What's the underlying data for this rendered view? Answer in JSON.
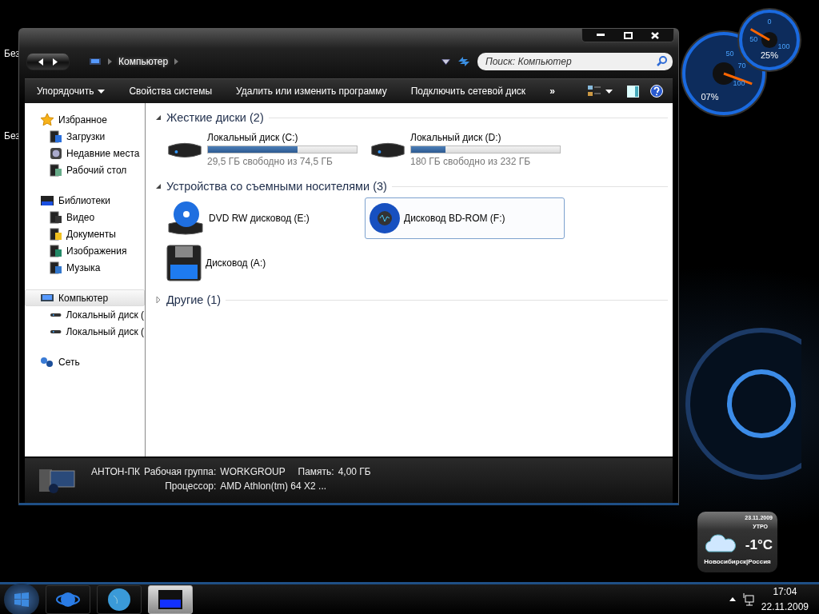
{
  "desktop": {
    "icon_labels": [
      "Без",
      "Без"
    ]
  },
  "gauges": [
    {
      "ticks": [
        "50",
        "70",
        "100"
      ],
      "reading": "07%"
    },
    {
      "ticks": [
        "0",
        "50",
        "100"
      ],
      "reading": "25%"
    }
  ],
  "window": {
    "breadcrumb": [
      "Компьютер"
    ],
    "search": {
      "placeholder": "Поиск: Компьютер"
    },
    "toolbar": {
      "items": [
        {
          "label": "Упорядочить",
          "kind": "menu"
        },
        {
          "label": "Свойства системы",
          "kind": "button"
        },
        {
          "label": "Удалить или изменить программу",
          "kind": "button"
        },
        {
          "label": "Подключить сетевой диск",
          "kind": "button"
        }
      ],
      "overflow": "»"
    },
    "sidebar": [
      {
        "label": "Избранное",
        "selected": false,
        "children": [
          {
            "label": "Загрузки",
            "selected": false
          },
          {
            "label": "Недавние места",
            "selected": false
          },
          {
            "label": "Рабочий стол",
            "selected": false
          }
        ]
      },
      {
        "label": "Библиотеки",
        "selected": false,
        "children": [
          {
            "label": "Видео",
            "selected": false
          },
          {
            "label": "Документы",
            "selected": false
          },
          {
            "label": "Изображения",
            "selected": false
          },
          {
            "label": "Музыка",
            "selected": false
          }
        ]
      },
      {
        "label": "Компьютер",
        "selected": true,
        "children": [
          {
            "label": "Локальный диск (",
            "selected": false
          },
          {
            "label": "Локальный диск (",
            "selected": false
          }
        ]
      },
      {
        "label": "Сеть",
        "selected": false
      }
    ],
    "groups": [
      {
        "title": "Жесткие диски (2)",
        "expanded": true,
        "items": [
          {
            "kind": "disk",
            "name": "Локальный диск (C:)",
            "level": 0.6,
            "free": "29,5 ГБ свободно из 74,5 ГБ",
            "selected": false
          },
          {
            "kind": "disk",
            "name": "Локальный диск (D:)",
            "level": 0.23,
            "free": "180 ГБ свободно из 232 ГБ",
            "selected": false
          }
        ]
      },
      {
        "title": "Устройства со съемными носителями (3)",
        "expanded": true,
        "items": [
          {
            "kind": "device",
            "name": "DVD RW дисковод (E:)",
            "selected": false
          },
          {
            "kind": "device",
            "name": "Дисковод BD-ROM (F:)",
            "selected": true
          },
          {
            "kind": "device",
            "name": "Дисковод (A:)",
            "selected": false
          }
        ]
      },
      {
        "title": "Другие (1)",
        "expanded": false
      }
    ],
    "details": {
      "name": "АНТОН-ПК",
      "rows": [
        [
          {
            "label": "Рабочая группа:",
            "value": "WORKGROUP"
          },
          {
            "label": "Память:",
            "value": "4,00 ГБ"
          }
        ],
        [
          {
            "label": "Процессор:",
            "value": "AMD Athlon(tm) 64 X2 ..."
          }
        ]
      ]
    }
  },
  "weather": {
    "date": "23.11.2009",
    "period": "УТРО",
    "temperature": "-1°C",
    "location": "Новосибирск|Россия"
  },
  "taskbar": {
    "apps": [
      {
        "selected": false
      },
      {
        "selected": false
      },
      {
        "selected": true
      }
    ],
    "time": "17:04",
    "date": "22.11.2009"
  }
}
